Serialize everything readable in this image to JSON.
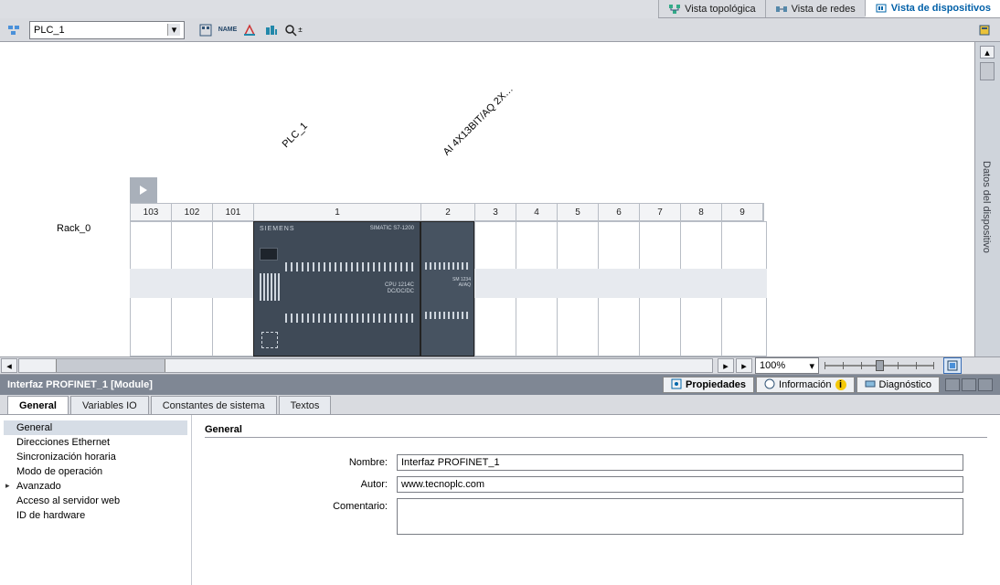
{
  "view_tabs": {
    "topology": "Vista topológica",
    "network": "Vista de redes",
    "devices": "Vista de dispositivos"
  },
  "toolbar": {
    "device": "PLC_1"
  },
  "canvas": {
    "plc_label": "PLC_1",
    "ai_label": "AI 4X13BIT/AQ 2X…",
    "rack_label": "Rack_0",
    "slots_small": [
      "103",
      "102",
      "101"
    ],
    "slot_1": "1",
    "slot_2": "2",
    "slots_tail": [
      "3",
      "4",
      "5",
      "6",
      "7",
      "8",
      "9"
    ],
    "cpu_brand": "SIEMENS",
    "cpu_model": "SIMATIC S7-1200",
    "cpu_type": "CPU 1214C\nDC/DC/DC",
    "ai_type": "SM 1234\nAI/AQ"
  },
  "right_panel": {
    "label": "Datos del dispositivo"
  },
  "zoom": {
    "value": "100%"
  },
  "module_bar": {
    "title": "Interfaz PROFINET_1 [Module]",
    "properties": "Propiedades",
    "information": "Información",
    "diagnostics": "Diagnóstico"
  },
  "prop_tabs": {
    "general": "General",
    "vars": "Variables IO",
    "consts": "Constantes de sistema",
    "texts": "Textos"
  },
  "tree": {
    "general": "General",
    "ethernet": "Direcciones Ethernet",
    "timesync": "Sincronización horaria",
    "opmode": "Modo de operación",
    "advanced": "Avanzado",
    "webserver": "Acceso al servidor web",
    "hwid": "ID de hardware"
  },
  "form": {
    "section": "General",
    "name_label": "Nombre:",
    "name_value": "Interfaz PROFINET_1",
    "author_label": "Autor:",
    "author_value": "www.tecnoplc.com",
    "comment_label": "Comentario:",
    "comment_value": ""
  }
}
